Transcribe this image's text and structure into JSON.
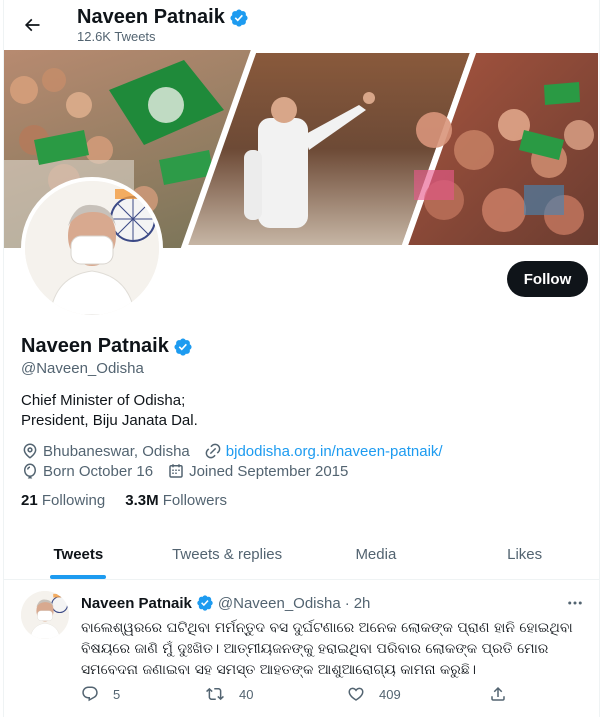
{
  "header": {
    "name": "Naveen Patnaik",
    "tweet_count": "12.6K Tweets"
  },
  "profile": {
    "name": "Naveen Patnaik",
    "handle": "@Naveen_Odisha",
    "bio_line1": "Chief Minister of Odisha;",
    "bio_line2": "President, Biju Janata Dal.",
    "location": "Bhubaneswar, Odisha",
    "website": "bjdodisha.org.in/naveen-patnaik/",
    "birthday": "Born October 16",
    "joined": "Joined September 2015",
    "following_count": "21",
    "following_label": "Following",
    "followers_count": "3.3M",
    "followers_label": "Followers",
    "follow_button": "Follow"
  },
  "tabs": [
    {
      "label": "Tweets",
      "active": true
    },
    {
      "label": "Tweets & replies",
      "active": false
    },
    {
      "label": "Media",
      "active": false
    },
    {
      "label": "Likes",
      "active": false
    }
  ],
  "tweet": {
    "name": "Naveen Patnaik",
    "handle": "@Naveen_Odisha",
    "separator": "·",
    "time": "2h",
    "text": "ବାଲେଶ୍ୱରରେ ଘଟିଥିବା ମର୍ମନ୍ତୁଦ ବସ ଦୁର୍ଘଟଣାରେ ଅନେକ ଲୋକଙ୍କ ପ୍ରାଣ ହାନି ହୋଇଥିବା ବିଷୟରେ ଜାଣି ମୁଁ ଦୁଃଖିତ। ଆତ୍ମୀୟଜନଙ୍କୁ ହରାଇଥିବା ପରିବାର ଲୋକଙ୍କ ପ୍ରତି ମୋର ସମବେଦନା ଜଣାଇବା ସହ ସମସ୍ତ ଆହତଙ୍କ ଆଶୁଆରୋଗ୍ୟ କାମନା କରୁଛି।",
    "replies": "5",
    "retweets": "40",
    "likes": "409"
  },
  "colors": {
    "accent": "#1d9bf0",
    "text": "#0f1419",
    "secondary": "#536471"
  },
  "icons": [
    "back-arrow-icon",
    "verified-badge-icon",
    "location-pin-icon",
    "link-icon",
    "balloon-icon",
    "calendar-icon",
    "more-icon",
    "reply-icon",
    "retweet-icon",
    "like-icon",
    "share-icon"
  ]
}
